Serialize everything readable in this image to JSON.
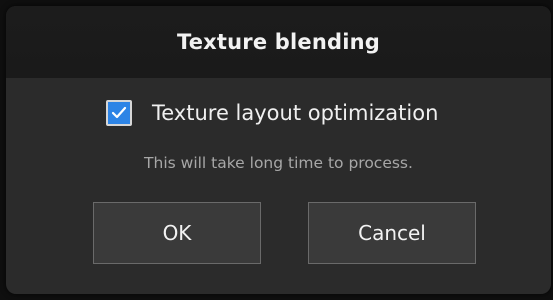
{
  "dialog": {
    "title": "Texture blending",
    "checkbox": {
      "label": "Texture layout optimization",
      "checked": true,
      "color": "#2d84e6",
      "icon": "checkmark-icon"
    },
    "note": "This will take long time to process.",
    "buttons": {
      "ok_label": "OK",
      "cancel_label": "Cancel"
    }
  }
}
